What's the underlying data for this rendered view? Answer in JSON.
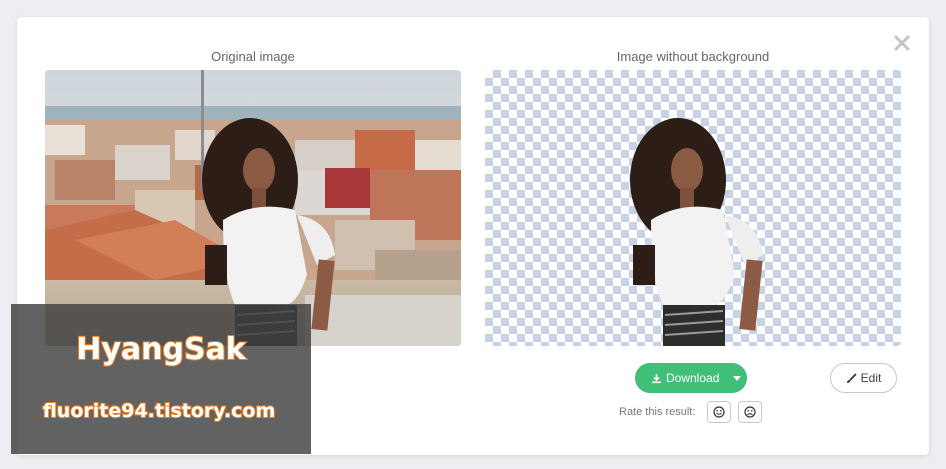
{
  "panes": {
    "original_title": "Original image",
    "result_title": "Image without background"
  },
  "actions": {
    "download_label": "Download",
    "edit_label": "Edit",
    "rate_label": "Rate this result:"
  },
  "icons": {
    "close": "close-icon",
    "download": "download-icon",
    "caret": "chevron-down-icon",
    "edit": "brush-icon",
    "good": "smile-icon",
    "bad": "frown-icon"
  },
  "colors": {
    "accent_green": "#3fbf78",
    "checker": "#c7d2e6",
    "watermark_stroke": "#f07d1c"
  },
  "watermark": {
    "name": "HyangSak",
    "url": "fluorite94.tistory.com"
  }
}
